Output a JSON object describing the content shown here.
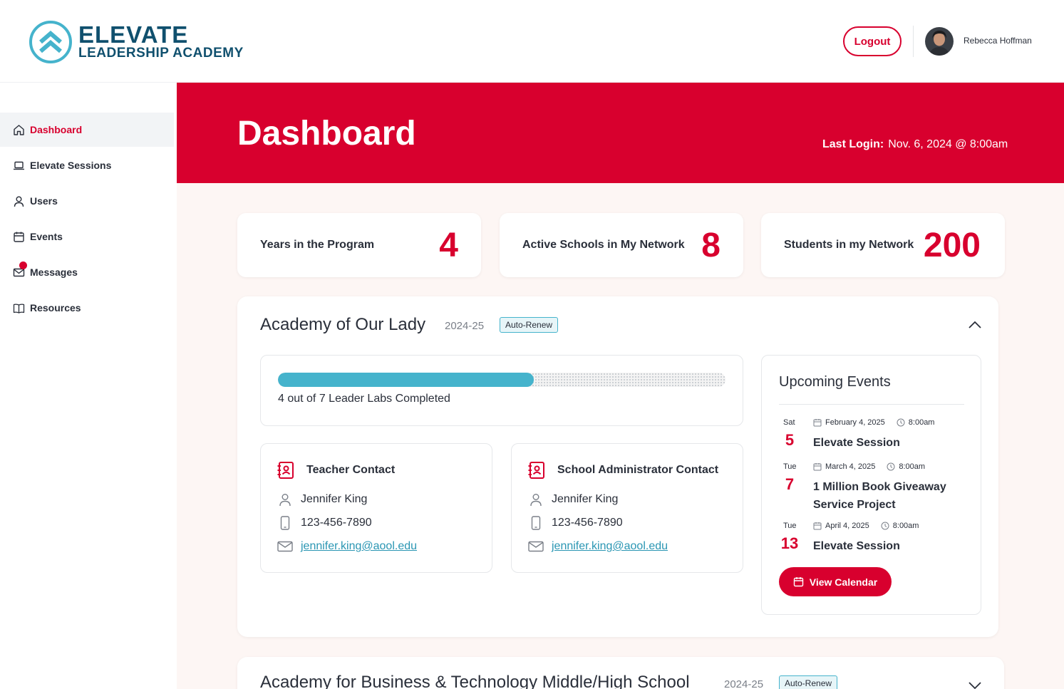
{
  "header": {
    "brand_line1": "ELEVATE",
    "brand_line2": "LEADERSHIP ACADEMY",
    "logout_label": "Logout",
    "user_name": "Rebecca Hoffman"
  },
  "sidebar": {
    "items": [
      {
        "label": "Dashboard",
        "icon": "home-icon",
        "active": true
      },
      {
        "label": "Elevate Sessions",
        "icon": "laptop-icon"
      },
      {
        "label": "Users",
        "icon": "user-icon"
      },
      {
        "label": "Events",
        "icon": "calendar-icon"
      },
      {
        "label": "Messages",
        "icon": "mail-icon",
        "notification": true
      },
      {
        "label": "Resources",
        "icon": "book-icon"
      }
    ]
  },
  "banner": {
    "title": "Dashboard",
    "last_login_label": "Last Login:",
    "last_login_value": "Nov. 6, 2024 @ 8:00am"
  },
  "stats": [
    {
      "label": "Years in the Program",
      "value": "4"
    },
    {
      "label": "Active Schools in My Network",
      "value": "8"
    },
    {
      "label": "Students in my Network",
      "value": "200"
    }
  ],
  "school": {
    "name": "Academy of Our Lady",
    "year": "2024-25",
    "badge": "Auto-Renew",
    "progress": {
      "completed": 4,
      "total": 7,
      "text": "4 out of 7 Leader Labs Completed"
    },
    "contacts": [
      {
        "title": "Teacher Contact",
        "name": "Jennifer King",
        "phone": "123-456-7890",
        "email": "jennifer.king@aool.edu"
      },
      {
        "title": "School Administrator Contact",
        "name": "Jennifer King",
        "phone": "123-456-7890",
        "email": "jennifer.king@aool.edu"
      }
    ],
    "events": {
      "title": "Upcoming Events",
      "items": [
        {
          "dow": "Sat",
          "day": "5",
          "date": "February 4, 2025",
          "time": "8:00am",
          "name": "Elevate Session"
        },
        {
          "dow": "Tue",
          "day": "7",
          "date": "March 4, 2025",
          "time": "8:00am",
          "name": "1 Million Book Giveaway Service Project"
        },
        {
          "dow": "Tue",
          "day": "13",
          "date": "April 4, 2025",
          "time": "8:00am",
          "name": "Elevate Session"
        }
      ],
      "button_label": "View Calendar"
    }
  },
  "school2": {
    "name": "Academy for Business & Technology Middle/High School",
    "year": "2024-25",
    "badge": "Auto-Renew"
  },
  "colors": {
    "accent": "#d8002e",
    "teal": "#45b3cc",
    "navy": "#10506e"
  }
}
